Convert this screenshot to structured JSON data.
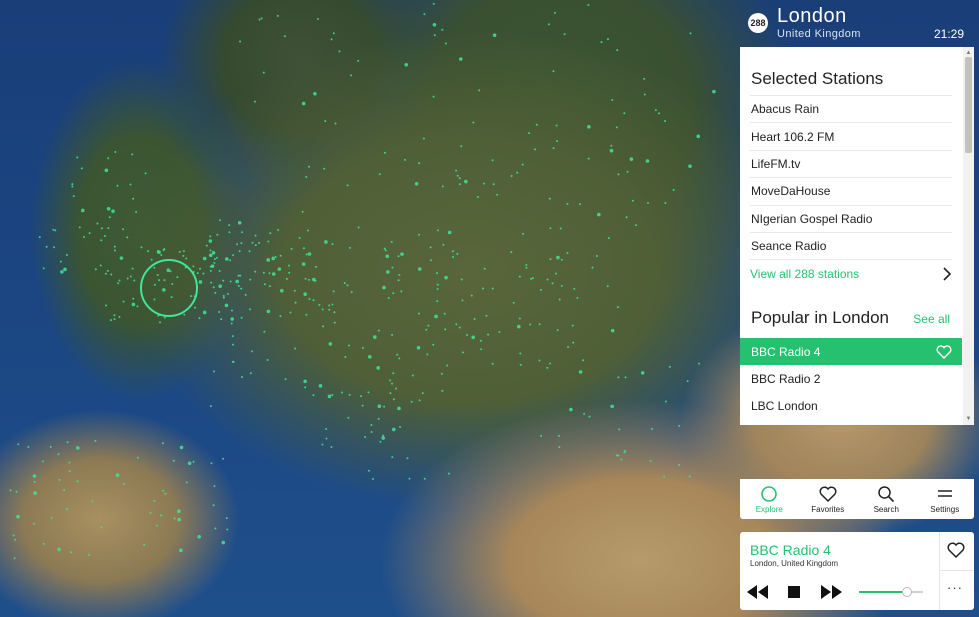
{
  "header": {
    "station_count": "288",
    "city": "London",
    "country": "United Kingdom",
    "time": "21:29"
  },
  "selected": {
    "title": "Selected Stations",
    "stations": [
      "Abacus Rain",
      "Heart 106.2 FM",
      "LifeFM.tv",
      "MoveDaHouse",
      "NIgerian Gospel Radio",
      "Seance Radio"
    ],
    "view_all": "View all 288 stations"
  },
  "popular": {
    "title": "Popular in London",
    "see_all": "See all",
    "stations": [
      "BBC Radio 4",
      "BBC Radio 2",
      "LBC London"
    ]
  },
  "nav": {
    "explore": "Explore",
    "favorites": "Favorites",
    "search": "Search",
    "settings": "Settings"
  },
  "player": {
    "station": "BBC Radio 4",
    "location": "London, United Kingdom",
    "more": "···",
    "volume_percent": 75
  },
  "colors": {
    "accent": "#25c16f",
    "ocean": "#1d4581"
  },
  "icons": {
    "explore": "circle-icon",
    "favorites": "heart-icon",
    "search": "search-icon",
    "settings": "menu-lines-icon"
  }
}
